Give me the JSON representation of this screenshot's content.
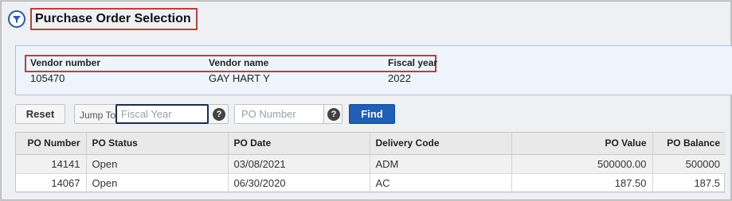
{
  "title": "Purchase Order Selection",
  "colors": {
    "accent": "#1f5fb5",
    "highlight_border": "#b8403a",
    "panel_bg": "#eef4fb"
  },
  "vendor": {
    "number_label": "Vendor number",
    "number_value": "105470",
    "name_label": "Vendor name",
    "name_value": "GAY HART Y",
    "fiscal_label": "Fiscal year",
    "fiscal_value": "2022"
  },
  "toolbar": {
    "reset_label": "Reset",
    "jump_label": "Jump To",
    "fiscal_placeholder": "Fiscal Year",
    "fiscal_value": "",
    "po_placeholder": "PO Number",
    "po_value": "",
    "help_icon": "question-circle-icon",
    "find_label": "Find"
  },
  "table": {
    "columns": [
      "PO Number",
      "PO Status",
      "PO Date",
      "Delivery Code",
      "PO Value",
      "PO Balance"
    ],
    "rows": [
      {
        "po_number": "14141",
        "status": "Open",
        "date": "03/08/2021",
        "delivery": "ADM",
        "value": "500000.00",
        "balance": "500000"
      },
      {
        "po_number": "14067",
        "status": "Open",
        "date": "06/30/2020",
        "delivery": "AC",
        "value": "187.50",
        "balance": "187.5"
      }
    ]
  }
}
